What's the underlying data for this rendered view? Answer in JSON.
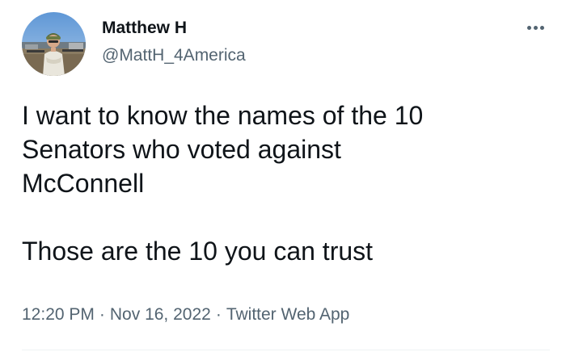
{
  "author": {
    "name": "Matthew H",
    "handle": "@MattH_4America"
  },
  "tweet": {
    "lines": [
      "I want to know the names of the 10",
      "Senators who voted against",
      "McConnell",
      "",
      "Those are the 10 you can trust"
    ]
  },
  "meta": {
    "time": "12:20 PM",
    "separator": "·",
    "date": "Nov 16, 2022",
    "source": "Twitter Web App"
  },
  "icons": {
    "more": "more-horizontal-icon"
  },
  "colors": {
    "text_primary": "#0f1419",
    "text_secondary": "#536471",
    "divider": "#eff3f4"
  }
}
